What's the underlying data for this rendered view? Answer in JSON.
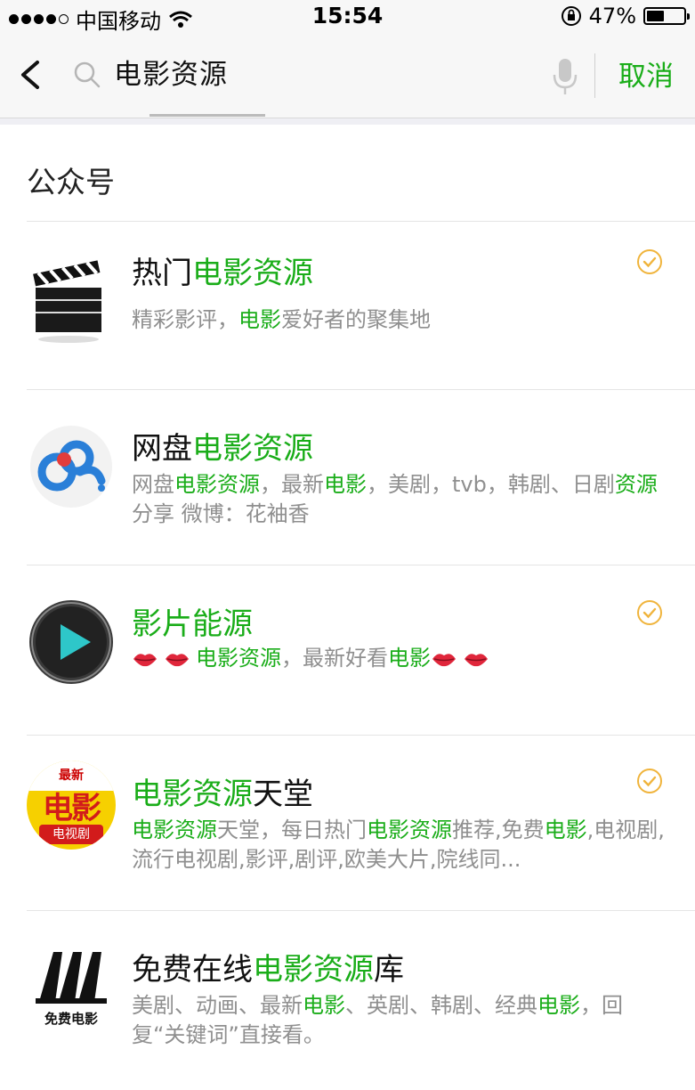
{
  "status_bar": {
    "carrier": "中国移动",
    "time": "15:54",
    "battery_percent": "47%",
    "battery_level": 0.47,
    "icons": [
      "signal-dots-icon",
      "wifi-icon",
      "orientation-lock-icon",
      "battery-icon"
    ]
  },
  "search": {
    "query": "电影资源",
    "cancel_label": "取消",
    "icons": [
      "back-arrow-icon",
      "search-icon",
      "microphone-icon"
    ]
  },
  "section": {
    "title": "公众号"
  },
  "results": [
    {
      "title_parts": [
        {
          "text": "热门"
        },
        {
          "text": "电影资源",
          "hl": true
        }
      ],
      "desc_parts": [
        {
          "text": "精彩影评，"
        },
        {
          "text": "电影",
          "hl": true
        },
        {
          "text": "爱好者的聚集地"
        }
      ],
      "verified": true,
      "avatar": "clapperboard-icon"
    },
    {
      "title_parts": [
        {
          "text": "网盘"
        },
        {
          "text": "电影资源",
          "hl": true
        }
      ],
      "desc_parts": [
        {
          "text": "网盘"
        },
        {
          "text": "电影资源",
          "hl": true
        },
        {
          "text": "，最新"
        },
        {
          "text": "电影",
          "hl": true
        },
        {
          "text": "，美剧，tvb，韩剧、日剧"
        },
        {
          "text": "资源",
          "hl": true
        },
        {
          "text": "分享 微博：花袖香"
        }
      ],
      "verified": false,
      "avatar": "baidu-cloud-logo"
    },
    {
      "title_parts": [
        {
          "text": "影片能源",
          "hl": true
        }
      ],
      "desc_parts": [
        {
          "lips": 2
        },
        {
          "text": "电影资源",
          "hl": true
        },
        {
          "text": "，最新好看"
        },
        {
          "text": "电影",
          "hl": true
        },
        {
          "lips": 2
        }
      ],
      "verified": true,
      "avatar": "play-button-logo"
    },
    {
      "title_parts": [
        {
          "text": "电影资源",
          "hl": true
        },
        {
          "text": "天堂"
        }
      ],
      "desc_parts": [
        {
          "text": "电影资源",
          "hl": true
        },
        {
          "text": "天堂，每日热门"
        },
        {
          "text": "电影资源",
          "hl": true
        },
        {
          "text": "推荐,免费"
        },
        {
          "text": "电影",
          "hl": true
        },
        {
          "text": ",电视剧,流行电视剧,影评,剧评,欧美大片,院线同..."
        }
      ],
      "verified": true,
      "avatar": "movie-tv-badge-logo",
      "avatar_text": {
        "top": "最新",
        "main": "电影",
        "bottom": "电视剧"
      }
    },
    {
      "title_parts": [
        {
          "text": "免费在线"
        },
        {
          "text": "电影资源",
          "hl": true
        },
        {
          "text": "库"
        }
      ],
      "desc_parts": [
        {
          "text": "美剧、动画、最新"
        },
        {
          "text": "电影",
          "hl": true
        },
        {
          "text": "、英剧、韩剧、经典"
        },
        {
          "text": "电影",
          "hl": true
        },
        {
          "text": "，回复“关键词”直接看。"
        }
      ],
      "verified": false,
      "avatar": "free-movie-logo",
      "avatar_text": {
        "main": "免费电影"
      }
    }
  ],
  "colors": {
    "accent": "#1aad19",
    "verified": "#f0b43c"
  }
}
